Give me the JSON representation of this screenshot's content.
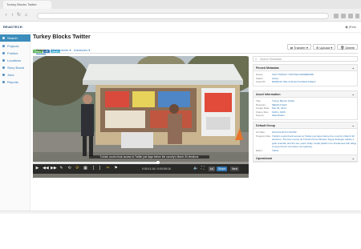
{
  "browser": {
    "tab_title": "Turkey Blocks Twitter",
    "user": "jPark"
  },
  "app": {
    "logo": "READTECH"
  },
  "sidebar": {
    "items": [
      {
        "label": "Search",
        "active": true
      },
      {
        "label": "Projects"
      },
      {
        "label": "Folders"
      },
      {
        "label": "Locations"
      },
      {
        "label": "Story Board"
      },
      {
        "label": "Jobs"
      },
      {
        "label": "Reports"
      }
    ]
  },
  "asset": {
    "title": "Turkey Blocks Twitter",
    "badges": [
      {
        "label": "Video",
        "color": "#5cb85c"
      },
      {
        "label": "HD",
        "color": "#337ab7"
      },
      {
        "label": "Clean",
        "color": "#5bc0de"
      }
    ],
    "actions": [
      "Transfer",
      "Upload",
      "Delete"
    ]
  },
  "tabs": [
    "Details",
    "Attachments",
    "Instances"
  ],
  "video": {
    "caption": "Turkish courts block access to Twitter just days before the country's March 30 elections",
    "timecode": "0:00:11:16 / 0:00:59:16",
    "progress": 0.58,
    "tags": [
      {
        "label": "sd",
        "color": "#555"
      },
      {
        "label": "Share",
        "color": "#337ab7"
      },
      {
        "label": "Next",
        "color": "#444"
      }
    ]
  },
  "panel": {
    "search_placeholder": "Search Metadata",
    "sections": [
      {
        "title": "Pinned Metadata",
        "rows": [
          {
            "k": "Name:",
            "v": "CNN TURKEY TWITTER 0009980FBD",
            "link": true
          },
          {
            "k": "Status:",
            "v": "Active",
            "link": true
          },
          {
            "k": "Asset ID:",
            "v": "8d9b8c4f-7f9e-4c16-9e7b-bf3a4c7d3a10",
            "link": true
          }
        ]
      },
      {
        "title": "Asset Information",
        "rows": [
          {
            "k": "Title:",
            "v": "Turkey Blocks Twitter",
            "link": true
          },
          {
            "k": "Directory:",
            "v": "MEDIA FILES",
            "link": true
          },
          {
            "k": "Create Date:",
            "v": "Mar 20, 2014",
            "link": true
          },
          {
            "k": "Frame Size:",
            "v": "1920 x 1080",
            "link": true
          },
          {
            "k": "Source:",
            "v": "Watchfolder",
            "link": true
          }
        ]
      },
      {
        "title": "Default Group",
        "rows": [
          {
            "k": "Air Date:",
            "v": "2014-03-20T17:00:00Z",
            "link": true
          },
          {
            "k": "Program Notes:",
            "v": "Turkish courts block access to Twitter just days before the country's March 30",
            "link": false
          },
          {
            "k": "",
            "v": "elections. The ban comes as Turkish Prime Minister Tayyip Erdogan battles a",
            "link": false
          },
          {
            "k": "",
            "v": "graft scandal, and the two years' leaky media platform he threatened with alleged evidence",
            "link": false
          },
          {
            "k": "",
            "v": "of government corruption wrongdoing.",
            "link": false
          },
          {
            "k": "Editor:",
            "v": "TECH",
            "link": true
          }
        ]
      },
      {
        "title": "Operational",
        "rows": []
      }
    ]
  }
}
